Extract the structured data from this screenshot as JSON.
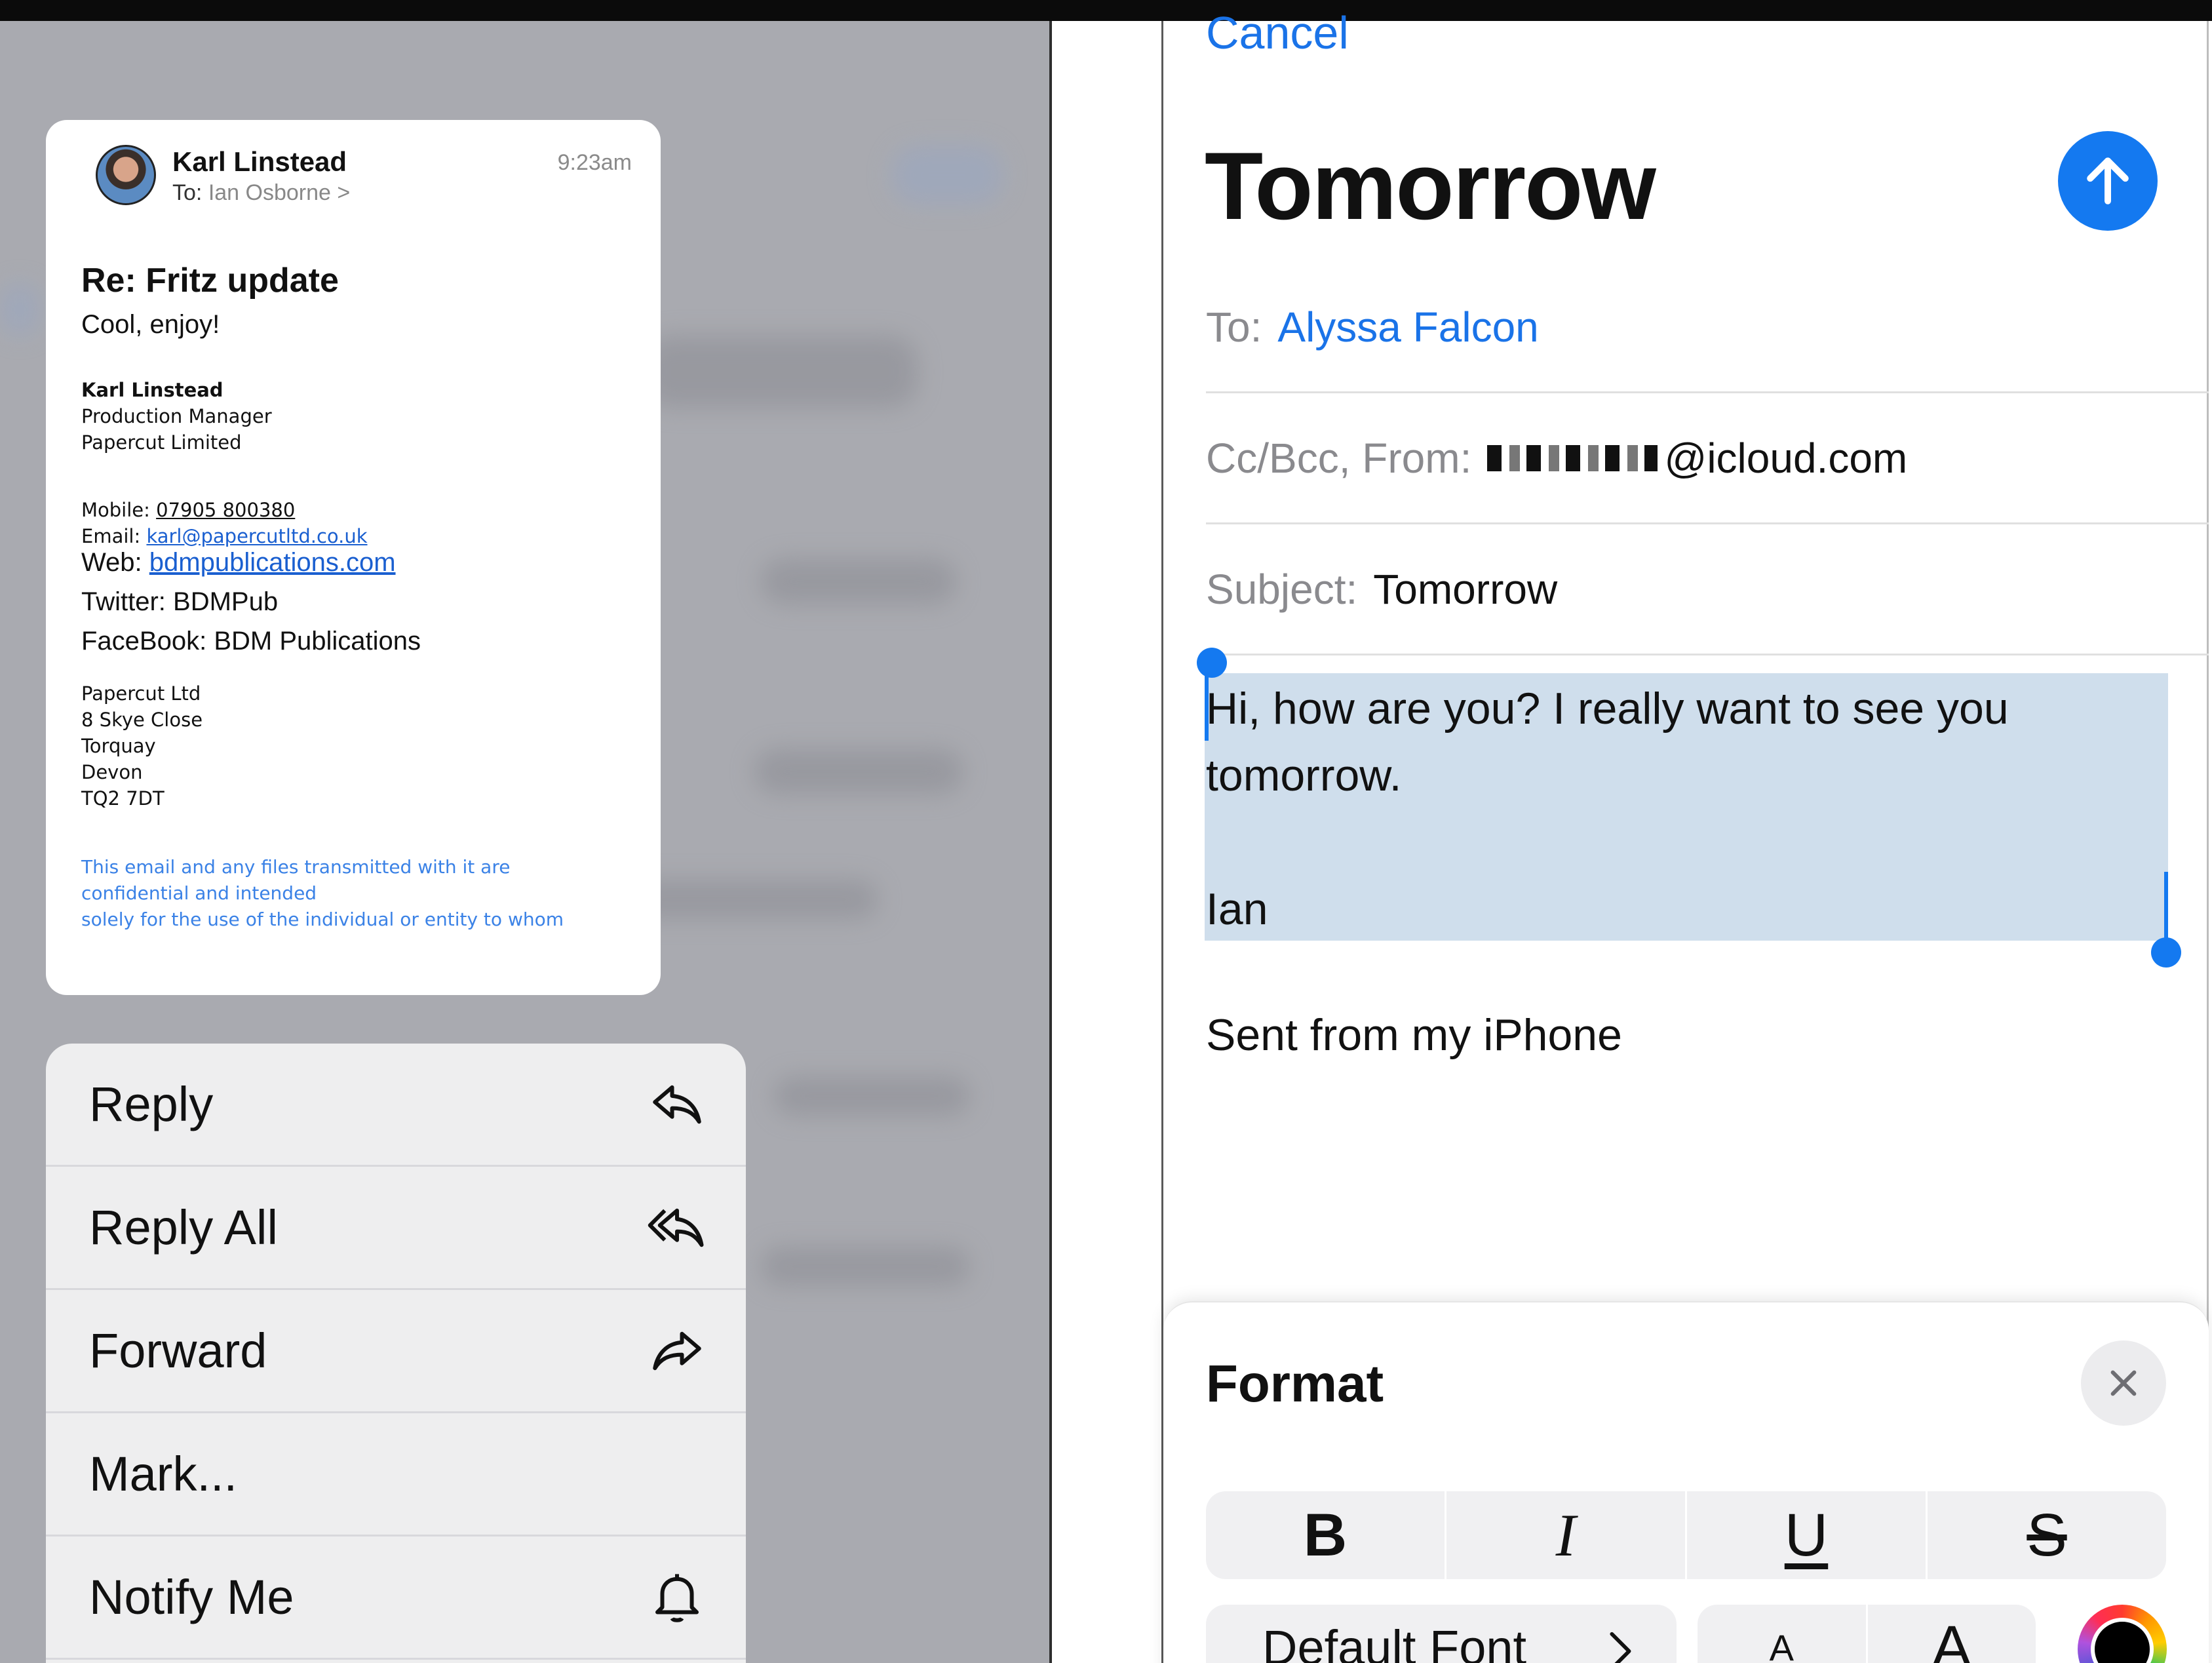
{
  "preview": {
    "sender": "Karl Linstead",
    "to_label": "To:",
    "to_value": "Ian Osborne >",
    "time": "9:23am",
    "subject": "Re:  Fritz update",
    "greeting": "Cool, enjoy!",
    "sig_name": "Karl Linstead",
    "sig_title": "Production Manager",
    "sig_company": "Papercut Limited",
    "mobile_label": "Mobile:",
    "mobile_value": "07905 800380",
    "email_label": "Email:",
    "email_value": "karl@papercutltd.co.uk",
    "web_label": "Web:",
    "web_value": "bdmpublications.com",
    "twitter": "Twitter: BDMPub",
    "facebook": "FaceBook: BDM Publications",
    "address": [
      "Papercut Ltd",
      "8 Skye Close",
      "Torquay",
      "Devon",
      "TQ2 7DT"
    ],
    "disclaimer": [
      "This email and any files transmitted with it are",
      "confidential and intended",
      "solely for the use of the individual or entity to whom"
    ]
  },
  "menu": {
    "items": [
      {
        "label": "Reply",
        "icon": "reply-icon"
      },
      {
        "label": "Reply All",
        "icon": "reply-all-icon"
      },
      {
        "label": "Forward",
        "icon": "forward-icon"
      },
      {
        "label": "Mark...",
        "icon": ""
      },
      {
        "label": "Notify Me",
        "icon": "bell-icon"
      }
    ]
  },
  "compose": {
    "cancel": "Cancel",
    "title": "Tomorrow",
    "to_label": "To:",
    "to_value": "Alyssa Falcon",
    "cc_label": "Cc/Bcc, From:",
    "from_value": "@icloud.com",
    "subject_label": "Subject:",
    "subject_value": "Tomorrow",
    "body_line1": "Hi, how are you? I really want to see you",
    "body_line2": "tomorrow.",
    "body_sign": "Ian",
    "sent_from": "Sent from my iPhone"
  },
  "format": {
    "title": "Format",
    "bold": "B",
    "italic": "I",
    "underline": "U",
    "strike": "S",
    "font": "Default Font",
    "size_small": "A",
    "size_large": "A",
    "colors": {
      "accent": "#1479f0",
      "selection": "#cfdeec"
    }
  }
}
